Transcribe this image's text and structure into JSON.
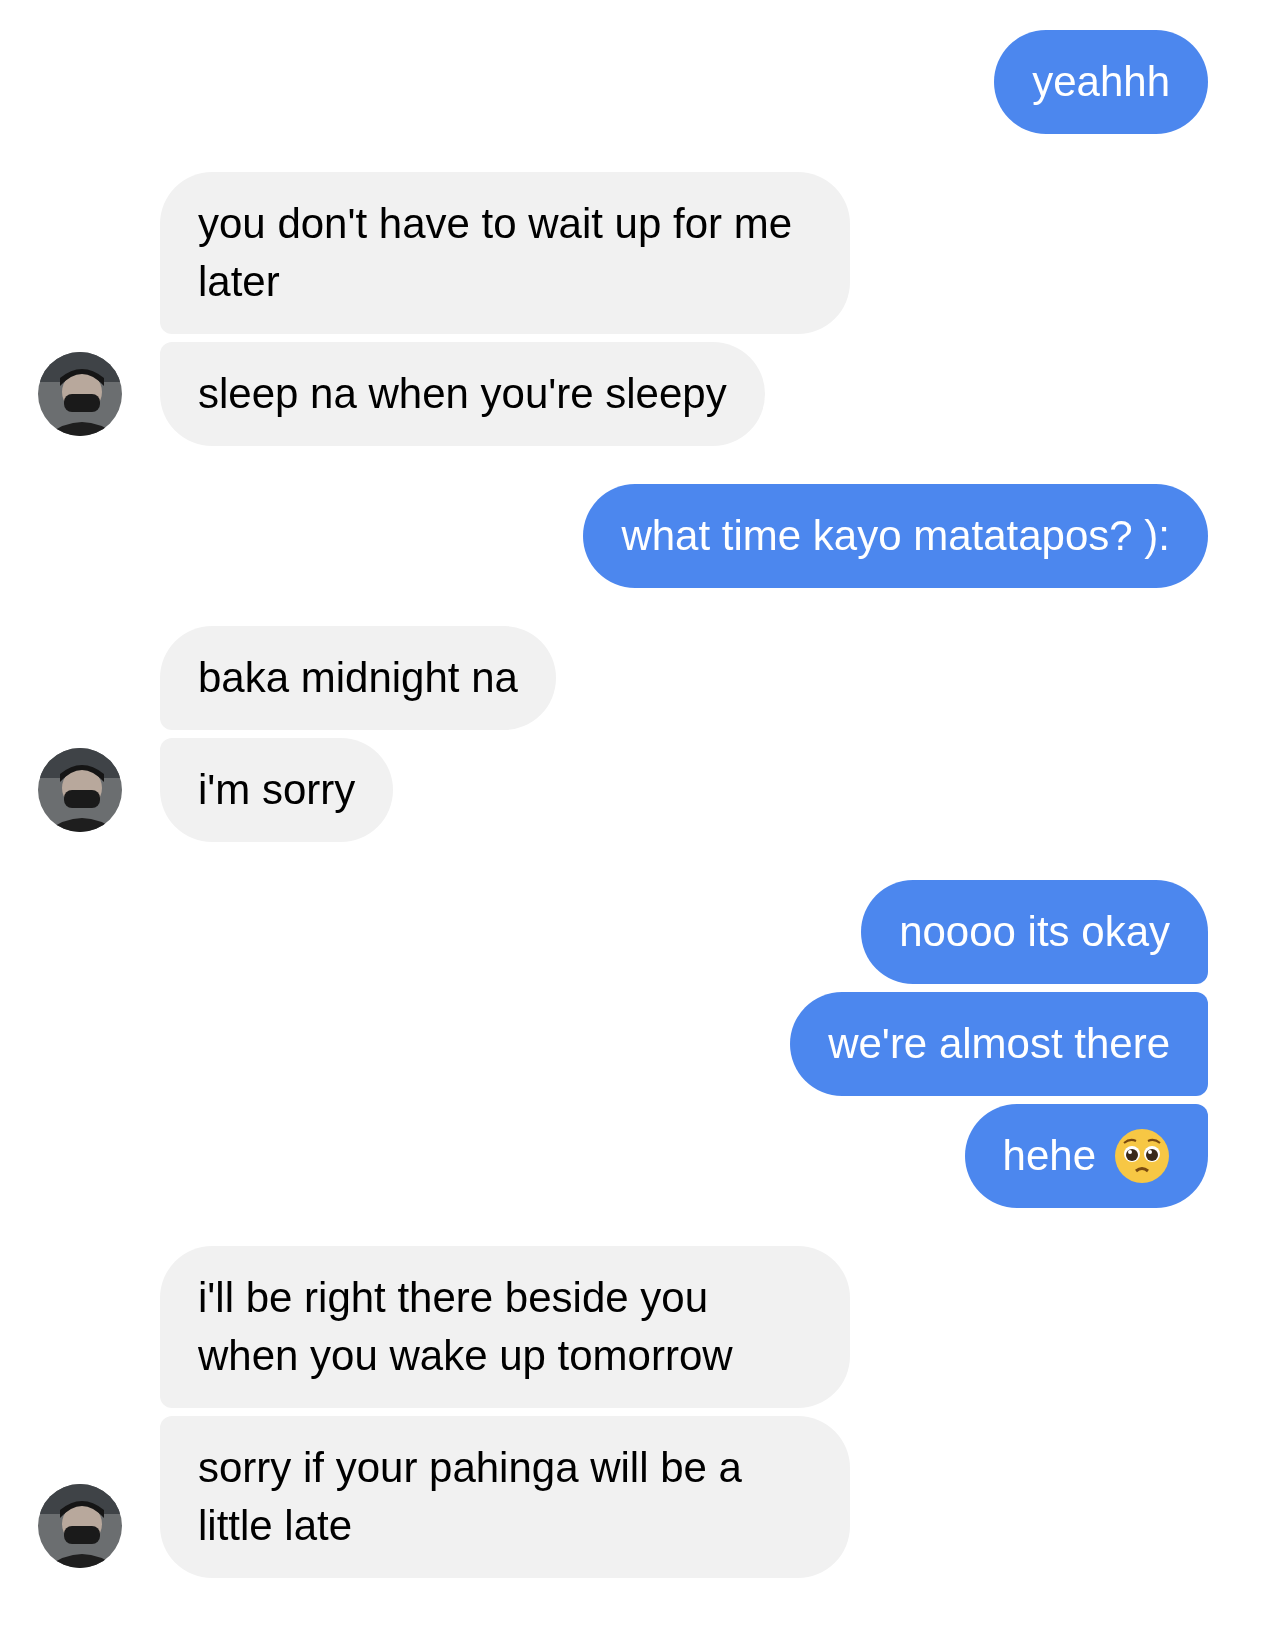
{
  "groups": [
    {
      "kind": "sent",
      "messages": [
        {
          "kind": "text",
          "text": "yeahhh"
        }
      ]
    },
    {
      "kind": "received",
      "messages": [
        {
          "kind": "text",
          "text": "you don't have to wait up for me later"
        },
        {
          "kind": "text",
          "text": "sleep na when you're sleepy"
        }
      ]
    },
    {
      "kind": "sent",
      "messages": [
        {
          "kind": "text",
          "text": "what time kayo matatapos? ):"
        }
      ]
    },
    {
      "kind": "received",
      "messages": [
        {
          "kind": "text",
          "text": "baka midnight na"
        },
        {
          "kind": "text",
          "text": "i'm sorry"
        }
      ]
    },
    {
      "kind": "sent",
      "messages": [
        {
          "kind": "text",
          "text": "noooo its okay"
        },
        {
          "kind": "text",
          "text": "we're almost there"
        },
        {
          "kind": "text_with_emoji",
          "text": "hehe"
        }
      ]
    },
    {
      "kind": "received",
      "messages": [
        {
          "kind": "text",
          "text": "i'll be right there beside you when you wake up tomorrow"
        },
        {
          "kind": "text",
          "text": "sorry if your pahinga will be a little late"
        }
      ]
    }
  ]
}
